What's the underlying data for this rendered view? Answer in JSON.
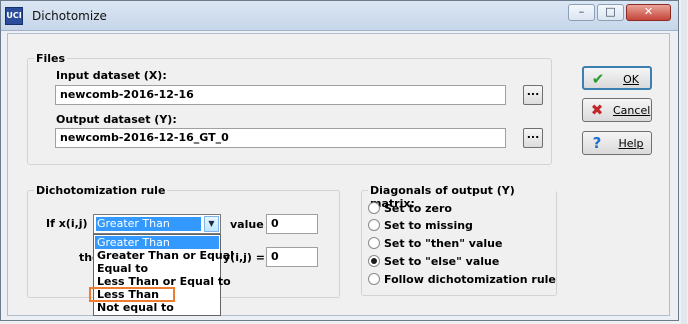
{
  "window": {
    "title": "Dichotomize",
    "app_icon_text": "UCI"
  },
  "titlebar_buttons": {
    "minimize": "–",
    "maximize": "□",
    "close": "✕"
  },
  "files": {
    "legend": "Files",
    "input_label": "Input dataset (X):",
    "input_value": "newcomb-2016-12-16",
    "output_label": "Output dataset (Y):",
    "output_value": "newcomb-2016-12-16_GT_0",
    "browse_label": "..."
  },
  "buttons": {
    "ok": "OK",
    "cancel": "Cancel",
    "help": "Help",
    "ok_icon": "checkmark-icon",
    "cancel_icon": "x-icon",
    "help_icon": "question-icon"
  },
  "rule": {
    "legend": "Dichotomization rule",
    "if_label": "If  x(i,j)",
    "selected_option": "Greater Than",
    "value_label": "value",
    "value": "0",
    "then_label": "the",
    "yij_label": "y(i,j) =",
    "yij_value": "0",
    "options": [
      "Greater Than",
      "Greater Than or Equal",
      "Equal to",
      "Less Than or Equal to",
      "Less Than",
      "Not equal to"
    ]
  },
  "diagonals": {
    "legend": "Diagonals of output (Y) matrix:",
    "options": [
      "Set to zero",
      "Set to missing",
      "Set to \"then\" value",
      "Set to \"else\" value",
      "Follow dichotomization rule"
    ],
    "selected_index": 3
  },
  "annotation": {
    "color": "#ed7d31",
    "target": "Less Than"
  }
}
